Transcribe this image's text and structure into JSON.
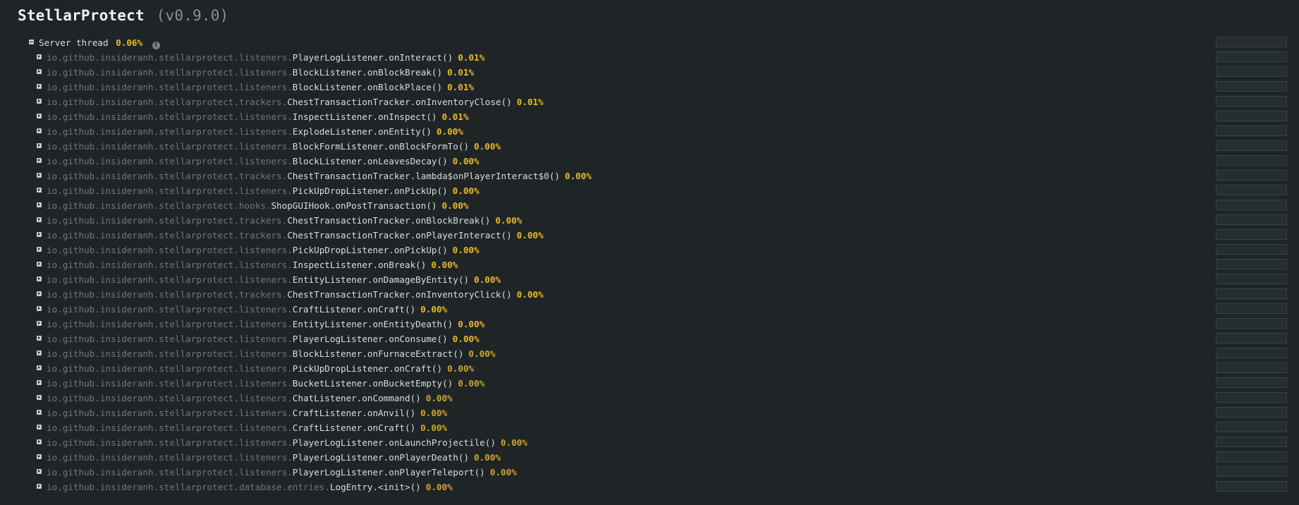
{
  "header": {
    "name": "StellarProtect",
    "version": "(v0.9.0)"
  },
  "root": {
    "label": "Server thread",
    "percent": "0.06%",
    "share": 0.0006
  },
  "entries": [
    {
      "pkg": "io.github.insideranh.stellarprotect.listeners.",
      "method": "PlayerLogListener.onInteract()",
      "percent": "0.01%",
      "share": 0.0001
    },
    {
      "pkg": "io.github.insideranh.stellarprotect.listeners.",
      "method": "BlockListener.onBlockBreak()",
      "percent": "0.01%",
      "share": 0.0001
    },
    {
      "pkg": "io.github.insideranh.stellarprotect.listeners.",
      "method": "BlockListener.onBlockPlace()",
      "percent": "0.01%",
      "share": 0.0001
    },
    {
      "pkg": "io.github.insideranh.stellarprotect.trackers.",
      "method": "ChestTransactionTracker.onInventoryClose()",
      "percent": "0.01%",
      "share": 0.0001
    },
    {
      "pkg": "io.github.insideranh.stellarprotect.listeners.",
      "method": "InspectListener.onInspect()",
      "percent": "0.01%",
      "share": 0.0001
    },
    {
      "pkg": "io.github.insideranh.stellarprotect.listeners.",
      "method": "ExplodeListener.onEntity()",
      "percent": "0.00%",
      "share": 0
    },
    {
      "pkg": "io.github.insideranh.stellarprotect.listeners.",
      "method": "BlockFormListener.onBlockFormTo()",
      "percent": "0.00%",
      "share": 0
    },
    {
      "pkg": "io.github.insideranh.stellarprotect.listeners.",
      "method": "BlockListener.onLeavesDecay()",
      "percent": "0.00%",
      "share": 0
    },
    {
      "pkg": "io.github.insideranh.stellarprotect.trackers.",
      "method": "ChestTransactionTracker.lambda$onPlayerInteract$0()",
      "percent": "0.00%",
      "share": 0
    },
    {
      "pkg": "io.github.insideranh.stellarprotect.listeners.",
      "method": "PickUpDropListener.onPickUp()",
      "percent": "0.00%",
      "share": 0
    },
    {
      "pkg": "io.github.insideranh.stellarprotect.hooks.",
      "method": "ShopGUIHook.onPostTransaction()",
      "percent": "0.00%",
      "share": 0
    },
    {
      "pkg": "io.github.insideranh.stellarprotect.trackers.",
      "method": "ChestTransactionTracker.onBlockBreak()",
      "percent": "0.00%",
      "share": 0
    },
    {
      "pkg": "io.github.insideranh.stellarprotect.trackers.",
      "method": "ChestTransactionTracker.onPlayerInteract()",
      "percent": "0.00%",
      "share": 0
    },
    {
      "pkg": "io.github.insideranh.stellarprotect.listeners.",
      "method": "PickUpDropListener.onPickUp()",
      "percent": "0.00%",
      "share": 0
    },
    {
      "pkg": "io.github.insideranh.stellarprotect.listeners.",
      "method": "InspectListener.onBreak()",
      "percent": "0.00%",
      "share": 0
    },
    {
      "pkg": "io.github.insideranh.stellarprotect.listeners.",
      "method": "EntityListener.onDamageByEntity()",
      "percent": "0.00%",
      "share": 0
    },
    {
      "pkg": "io.github.insideranh.stellarprotect.trackers.",
      "method": "ChestTransactionTracker.onInventoryClick()",
      "percent": "0.00%",
      "share": 0
    },
    {
      "pkg": "io.github.insideranh.stellarprotect.listeners.",
      "method": "CraftListener.onCraft()",
      "percent": "0.00%",
      "share": 0
    },
    {
      "pkg": "io.github.insideranh.stellarprotect.listeners.",
      "method": "EntityListener.onEntityDeath()",
      "percent": "0.00%",
      "share": 0
    },
    {
      "pkg": "io.github.insideranh.stellarprotect.listeners.",
      "method": "PlayerLogListener.onConsume()",
      "percent": "0.00%",
      "share": 0
    },
    {
      "pkg": "io.github.insideranh.stellarprotect.listeners.",
      "method": "BlockListener.onFurnaceExtract()",
      "percent": "0.00%",
      "share": 0,
      "dim": true
    },
    {
      "pkg": "io.github.insideranh.stellarprotect.listeners.",
      "method": "PickUpDropListener.onCraft()",
      "percent": "0.00%",
      "share": 0,
      "dim": true
    },
    {
      "pkg": "io.github.insideranh.stellarprotect.listeners.",
      "method": "BucketListener.onBucketEmpty()",
      "percent": "0.00%",
      "share": 0,
      "dim": true
    },
    {
      "pkg": "io.github.insideranh.stellarprotect.listeners.",
      "method": "ChatListener.onCommand()",
      "percent": "0.00%",
      "share": 0,
      "dim": true
    },
    {
      "pkg": "io.github.insideranh.stellarprotect.listeners.",
      "method": "CraftListener.onAnvil()",
      "percent": "0.00%",
      "share": 0,
      "dim": true
    },
    {
      "pkg": "io.github.insideranh.stellarprotect.listeners.",
      "method": "CraftListener.onCraft()",
      "percent": "0.00%",
      "share": 0,
      "dim": true
    },
    {
      "pkg": "io.github.insideranh.stellarprotect.listeners.",
      "method": "PlayerLogListener.onLaunchProjectile()",
      "percent": "0.00%",
      "share": 0,
      "dim": true
    },
    {
      "pkg": "io.github.insideranh.stellarprotect.listeners.",
      "method": "PlayerLogListener.onPlayerDeath()",
      "percent": "0.00%",
      "share": 0,
      "dim": true
    },
    {
      "pkg": "io.github.insideranh.stellarprotect.listeners.",
      "method": "PlayerLogListener.onPlayerTeleport()",
      "percent": "0.00%",
      "share": 0,
      "dim": true
    },
    {
      "pkg": "io.github.insideranh.stellarprotect.database.entries.",
      "method": "LogEntry.<init>()",
      "percent": "0.00%",
      "share": 0,
      "dim": true
    }
  ],
  "icons": {
    "expand": "expand-toggle-icon",
    "collapse": "collapse-toggle-icon",
    "info": "info-icon"
  },
  "colors": {
    "background": "#1f2527",
    "package": "#6e777b",
    "method": "#d9dcdd",
    "percent": "#e8b92a"
  }
}
